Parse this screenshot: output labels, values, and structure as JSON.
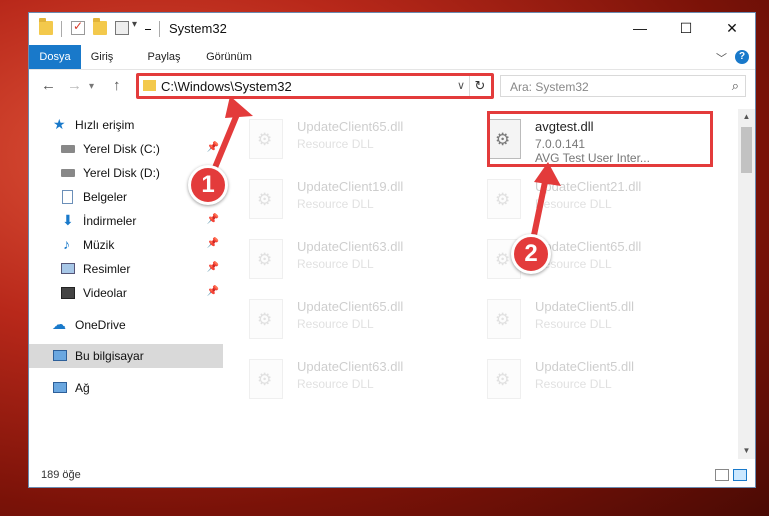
{
  "window": {
    "title": "System32"
  },
  "ribbon": {
    "tabs": [
      "Dosya",
      "Giriş",
      "Paylaş",
      "Görünüm"
    ]
  },
  "nav": {
    "address": "C:\\Windows\\System32",
    "search_placeholder": "Ara: System32"
  },
  "sidebar": {
    "items": [
      {
        "label": "Hızlı erişim",
        "icon": "star-icon"
      },
      {
        "label": "Yerel Disk (C:)",
        "icon": "drive-icon"
      },
      {
        "label": "Yerel Disk (D:)",
        "icon": "drive-icon"
      },
      {
        "label": "Belgeler",
        "icon": "documents-icon"
      },
      {
        "label": "İndirmeler",
        "icon": "download-icon"
      },
      {
        "label": "Müzik",
        "icon": "music-icon"
      },
      {
        "label": "Resimler",
        "icon": "pictures-icon"
      },
      {
        "label": "Videolar",
        "icon": "videos-icon"
      },
      {
        "label": "OneDrive",
        "icon": "cloud-icon"
      },
      {
        "label": "Bu bilgisayar",
        "icon": "computer-icon"
      },
      {
        "label": "Ağ",
        "icon": "network-icon"
      }
    ]
  },
  "files": [
    {
      "name": "UpdateClient65.dll",
      "type": "Resource DLL"
    },
    {
      "name": "avgtest.dll",
      "version": "7.0.0.141",
      "desc": "AVG Test User Inter..."
    },
    {
      "name": "UpdateClient19.dll",
      "type": "Resource DLL"
    },
    {
      "name": "UpdateClient21.dll",
      "type": "Resource DLL"
    },
    {
      "name": "UpdateClient63.dll",
      "type": "Resource DLL"
    },
    {
      "name": "UpdateClient65.dll",
      "type": "Resource DLL"
    },
    {
      "name": "UpdateClient65.dll",
      "type": "Resource DLL"
    },
    {
      "name": "UpdateClient5.dll",
      "type": "Resource DLL"
    },
    {
      "name": "UpdateClient63.dll",
      "type": "Resource DLL"
    },
    {
      "name": "UpdateClient5.dll",
      "type": "Resource DLL"
    }
  ],
  "status": {
    "count": "189 öğe"
  },
  "callouts": {
    "one": "1",
    "two": "2"
  },
  "colors": {
    "accent": "#1979ca",
    "highlight": "#e33b3b"
  }
}
